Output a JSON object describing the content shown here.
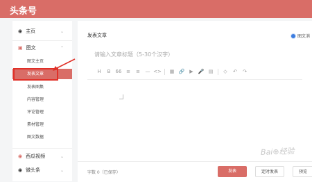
{
  "brand": "头条号",
  "sidebar": {
    "home": {
      "label": "主页"
    },
    "article": {
      "label": "图文"
    },
    "article_items": [
      "图文主页",
      "发表文章",
      "发表图集",
      "内容管理",
      "评论管理",
      "素材管理",
      "图文数据"
    ],
    "video": {
      "label": "西瓜视频"
    },
    "weitoutiao": {
      "label": "微头条"
    }
  },
  "main": {
    "title": "发表文章",
    "publish_type": "图文消",
    "title_placeholder": "请输入文章标题（5-30个汉字）",
    "toolbar": [
      "H",
      "B",
      "66",
      "≡",
      "≡",
      "—",
      "<>",
      "▦",
      "🔗",
      "▶",
      "🎤",
      "▤",
      "◇",
      "↶",
      "↷"
    ]
  },
  "footer": {
    "word_count": "字数 0（已保存）",
    "publish": "发表",
    "timed_publish": "定时发表",
    "preview": "预览"
  },
  "watermark": "Bai⊕经验",
  "accent": "#d96d67"
}
